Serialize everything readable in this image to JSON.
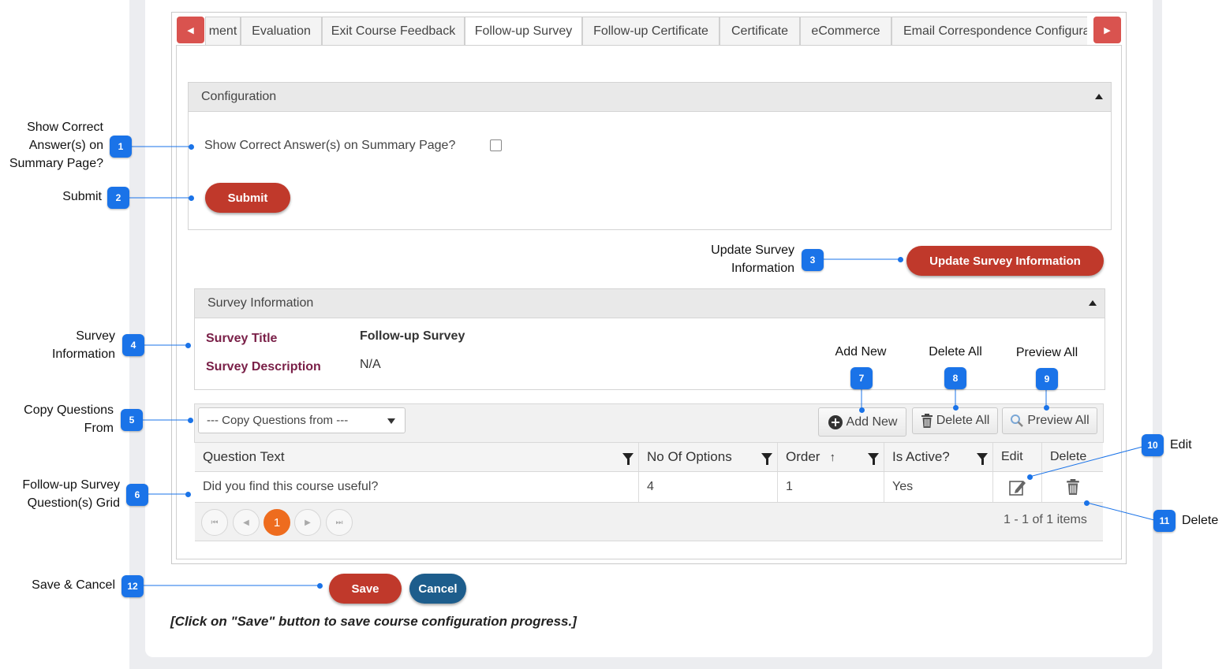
{
  "tabs": [
    {
      "label": "ment"
    },
    {
      "label": "Evaluation"
    },
    {
      "label": "Exit Course Feedback"
    },
    {
      "label": "Follow-up Survey",
      "active": true
    },
    {
      "label": "Follow-up Certificate"
    },
    {
      "label": "Certificate"
    },
    {
      "label": "eCommerce"
    },
    {
      "label": "Email Correspondence Configurat"
    }
  ],
  "configuration": {
    "title": "Configuration",
    "show_correct_label": "Show Correct Answer(s) on Summary Page?",
    "show_correct_checked": false,
    "submit_label": "Submit"
  },
  "update_survey_label": "Update Survey Information",
  "survey_info": {
    "title": "Survey Information",
    "survey_title_label": "Survey Title",
    "survey_title_value": "Follow-up Survey",
    "survey_description_label": "Survey Description",
    "survey_description_value": "N/A"
  },
  "toolbar": {
    "copy_placeholder": "--- Copy Questions from ---",
    "add_new": "Add New",
    "delete_all": "Delete All",
    "preview_all": "Preview All"
  },
  "grid": {
    "headers": {
      "question_text": "Question Text",
      "no_of_options": "No Of Options",
      "order": "Order",
      "is_active": "Is Active?",
      "edit": "Edit",
      "delete": "Delete"
    },
    "rows": [
      {
        "question_text": "Did you find this course useful?",
        "no_of_options": "4",
        "order": "1",
        "is_active": "Yes"
      }
    ],
    "pager": {
      "current_page": "1",
      "summary": "1 - 1 of 1 items"
    }
  },
  "actions": {
    "save": "Save",
    "cancel": "Cancel"
  },
  "note": "[Click on \"Save\" button to save course configuration progress.]",
  "annotations": {
    "a1": {
      "num": "1",
      "text": "Show Correct\nAnswer(s) on\nSummary Page?"
    },
    "a2": {
      "num": "2",
      "text": "Submit"
    },
    "a3": {
      "num": "3",
      "text": "Update Survey\nInformation"
    },
    "a4": {
      "num": "4",
      "text": "Survey\nInformation"
    },
    "a5": {
      "num": "5",
      "text": "Copy Questions\nFrom"
    },
    "a6": {
      "num": "6",
      "text": "Follow-up Survey\nQuestion(s) Grid"
    },
    "a7": {
      "num": "7",
      "text": "Add New"
    },
    "a8": {
      "num": "8",
      "text": "Delete All"
    },
    "a9": {
      "num": "9",
      "text": "Preview All"
    },
    "a10": {
      "num": "10",
      "text": "Edit"
    },
    "a11": {
      "num": "11",
      "text": "Delete"
    },
    "a12": {
      "num": "12",
      "text": "Save & Cancel"
    }
  },
  "colors": {
    "accent_red": "#c0392b",
    "cancel_blue": "#1d5d8c",
    "badge_blue": "#1a73e8",
    "pager_orange": "#ee6c1e"
  }
}
